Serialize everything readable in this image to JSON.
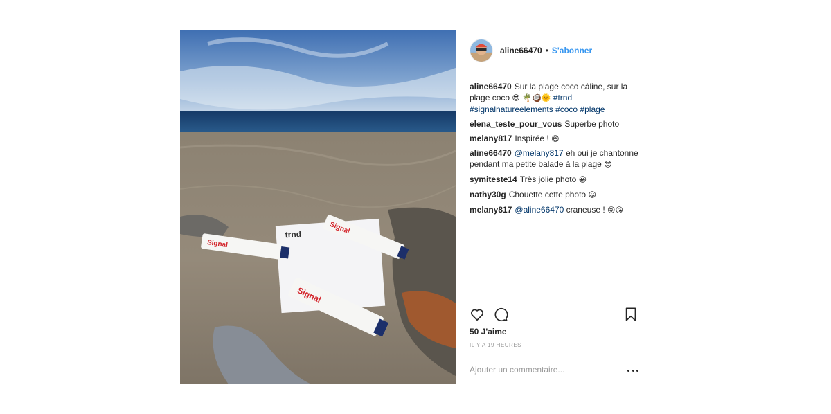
{
  "post": {
    "author": "aline66470",
    "separator": "•",
    "follow_label": "S'abonner",
    "photo_label": "trnd"
  },
  "comments": [
    {
      "user": "aline66470",
      "parts": [
        {
          "type": "text",
          "value": "Sur la plage coco câline, sur la plage coco "
        },
        {
          "type": "emoji",
          "value": "😎 🌴🥥🌞"
        },
        {
          "type": "tag",
          "value": " #trnd"
        },
        {
          "type": "tag",
          "value": " #signalnatureelements"
        },
        {
          "type": "tag",
          "value": " #coco"
        },
        {
          "type": "tag",
          "value": " #plage"
        }
      ]
    },
    {
      "user": "elena_teste_pour_vous",
      "parts": [
        {
          "type": "text",
          "value": "Superbe photo"
        }
      ]
    },
    {
      "user": "melany817",
      "parts": [
        {
          "type": "text",
          "value": "Inspirée ! "
        },
        {
          "type": "emoji",
          "value": "😄"
        }
      ]
    },
    {
      "user": "aline66470",
      "parts": [
        {
          "type": "mention",
          "value": "@melany817"
        },
        {
          "type": "text",
          "value": " eh oui je chantonne pendant ma petite balade à la plage "
        },
        {
          "type": "emoji",
          "value": "😎"
        }
      ]
    },
    {
      "user": "symiteste14",
      "parts": [
        {
          "type": "text",
          "value": "Très jolie photo "
        },
        {
          "type": "emoji",
          "value": "😀"
        }
      ]
    },
    {
      "user": "nathy30g",
      "parts": [
        {
          "type": "text",
          "value": "Chouette cette photo "
        },
        {
          "type": "emoji",
          "value": "😀"
        }
      ]
    },
    {
      "user": "melany817",
      "parts": [
        {
          "type": "mention",
          "value": "@aline66470"
        },
        {
          "type": "text",
          "value": " craneuse ! "
        },
        {
          "type": "emoji",
          "value": "😜😘"
        }
      ]
    }
  ],
  "actions": {
    "like_icon": "heart-icon",
    "comment_icon": "comment-bubble-icon",
    "save_icon": "bookmark-icon",
    "more_icon": "more-options-icon"
  },
  "likes_label": "50 J'aime",
  "time_label": "IL Y A 19 HEURES",
  "add_comment_placeholder": "Ajouter un commentaire..."
}
